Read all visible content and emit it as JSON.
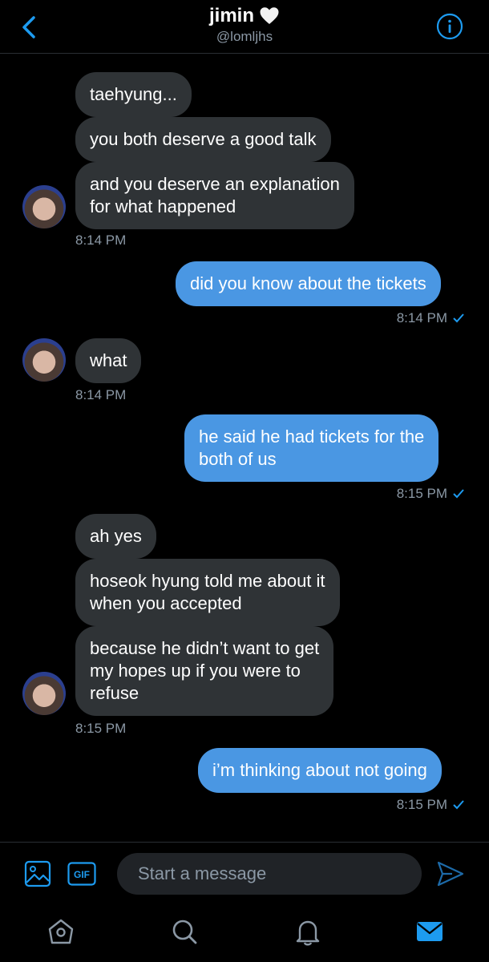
{
  "header": {
    "name": "jimin",
    "handle": "@lomljhs"
  },
  "messages": [
    {
      "text": "taehyung..."
    },
    {
      "text": "you both deserve a good talk"
    },
    {
      "line1": "and you deserve an explanation",
      "line2": "for what happened"
    },
    {
      "time": "8:14 PM"
    },
    {
      "text": "did you know about the tickets",
      "time": "8:14 PM"
    },
    {
      "text": "what",
      "time": "8:14 PM"
    },
    {
      "line1": "he said he had tickets for the",
      "line2": "both of us",
      "time": "8:15 PM"
    },
    {
      "text": "ah yes"
    },
    {
      "line1": "hoseok hyung told me about it",
      "line2": "when you accepted"
    },
    {
      "line1": "because he didn’t want to get",
      "line2": "my hopes up if you were to",
      "line3": "refuse",
      "time": "8:15 PM"
    },
    {
      "text": "i’m thinking about not going",
      "time": "8:15 PM"
    }
  ],
  "composer": {
    "placeholder": "Start a message",
    "gif_label": "GIF"
  },
  "colors": {
    "accent": "#1d9bf0",
    "sent_bubble": "#4a97e3",
    "received_bubble": "#2f3336",
    "muted_text": "#8b98a5"
  },
  "icons": {
    "back": "chevron-left-icon",
    "info": "info-icon",
    "heart": "white-heart-icon",
    "image": "image-icon",
    "gif": "gif-icon",
    "send": "send-icon",
    "home": "home-icon",
    "search": "search-icon",
    "notifications": "bell-icon",
    "messages": "mail-icon"
  }
}
